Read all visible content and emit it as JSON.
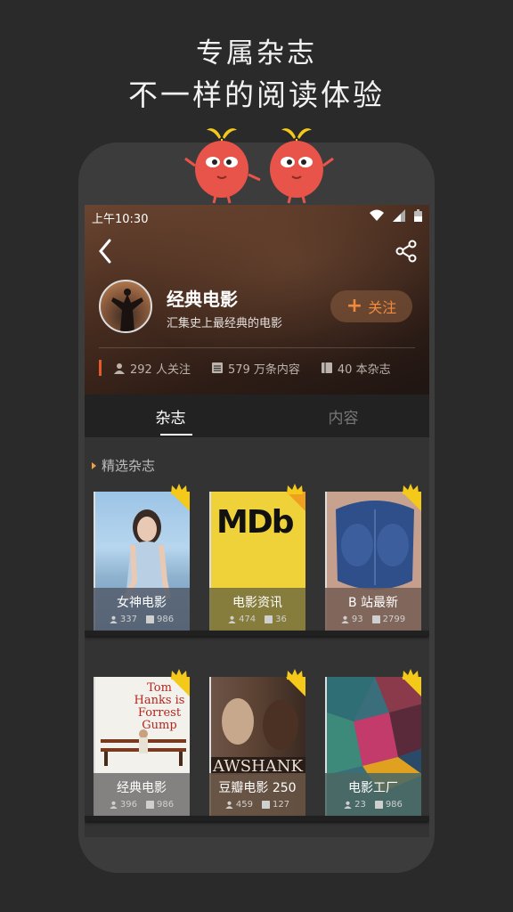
{
  "promo": {
    "line1": "专属杂志",
    "line2": "不一样的阅读体验"
  },
  "status": {
    "time": "上午10:30"
  },
  "channel": {
    "name": "经典电影",
    "description": "汇集史上最经典的电影",
    "follow_label": "关注",
    "stats": {
      "followers": "292 人关注",
      "contents": "579 万条内容",
      "magazines": "40 本杂志"
    }
  },
  "tabs": [
    {
      "label": "杂志",
      "active": true
    },
    {
      "label": "内容",
      "active": false
    }
  ],
  "section": {
    "title": "精选杂志"
  },
  "magazines": [
    {
      "name": "女神电影",
      "followers": "337",
      "items": "986",
      "cover_text": ""
    },
    {
      "name": "电影资讯",
      "followers": "474",
      "items": "36",
      "cover_text": "MDb"
    },
    {
      "name": "B 站最新",
      "followers": "93",
      "items": "2799",
      "cover_text": ""
    },
    {
      "name": "经典电影",
      "followers": "396",
      "items": "986",
      "cover_text": "Tom Hanks is Forrest Gump"
    },
    {
      "name": "豆瓣电影 250",
      "followers": "459",
      "items": "127",
      "cover_text": "AWSHANK"
    },
    {
      "name": "电影工厂",
      "followers": "23",
      "items": "986",
      "cover_text": ""
    }
  ],
  "colors": {
    "accent": "#f08a3c",
    "crown": "#f4c91a",
    "mascot": "#e8534a"
  }
}
